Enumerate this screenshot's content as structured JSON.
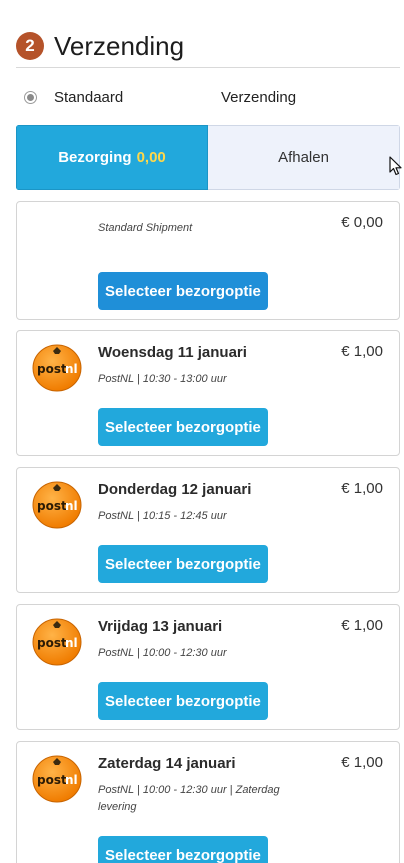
{
  "section": {
    "step_number": "2",
    "title": "Verzending"
  },
  "method": {
    "name": "Standaard",
    "type": "Verzending"
  },
  "tabs": {
    "delivery_label": "Bezorging",
    "delivery_price": "0,00",
    "pickup_label": "Afhalen"
  },
  "colors": {
    "accent": "#22a8dc",
    "step_badge": "#b5532a",
    "price_highlight": "#ffd84a"
  },
  "options": [
    {
      "date": "",
      "meta": "Standard Shipment",
      "price": "€ 0,00",
      "button": "Selecteer bezorgoptie",
      "logo": ""
    },
    {
      "date": "Woensdag 11 januari",
      "meta": "PostNL | 10:30 - 13:00 uur",
      "price": "€ 1,00",
      "button": "Selecteer bezorgoptie",
      "logo": "postnl"
    },
    {
      "date": "Donderdag 12 januari",
      "meta": "PostNL | 10:15 - 12:45 uur",
      "price": "€ 1,00",
      "button": "Selecteer bezorgoptie",
      "logo": "postnl"
    },
    {
      "date": "Vrijdag 13 januari",
      "meta": "PostNL | 10:00 - 12:30 uur",
      "price": "€ 1,00",
      "button": "Selecteer bezorgoptie",
      "logo": "postnl"
    },
    {
      "date": "Zaterdag 14 januari",
      "meta": "PostNL | 10:00 - 12:30 uur | Zaterdag levering",
      "price": "€ 1,00",
      "button": "Selecteer bezorgoptie",
      "logo": "postnl"
    }
  ]
}
